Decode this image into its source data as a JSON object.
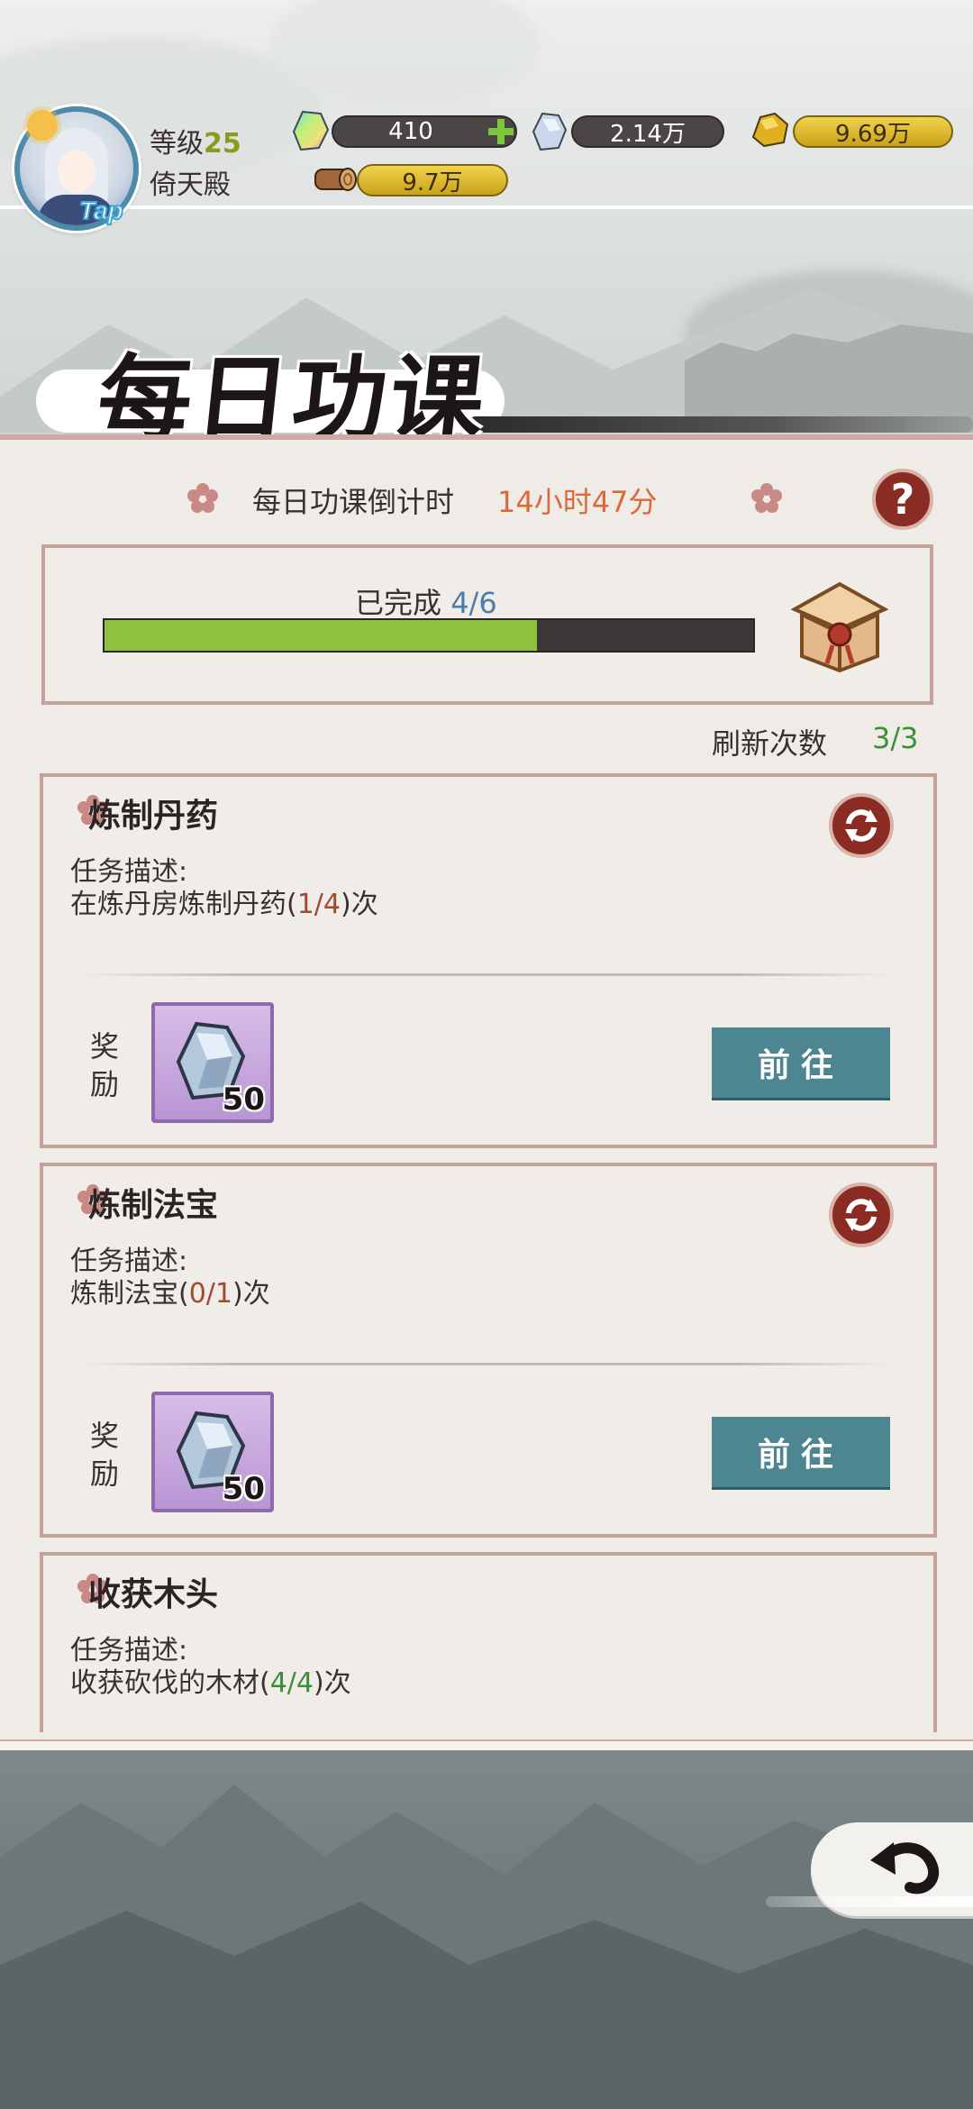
{
  "player": {
    "level_label": "等级",
    "level_value": "25",
    "sect_name": "倚天殿",
    "tap_badge": "Tap",
    "avatar_icon": "player-avatar"
  },
  "resources": [
    {
      "name": "spirit-stone-rainbow",
      "value": "410",
      "has_plus": true
    },
    {
      "name": "crystal",
      "value": "2.14万"
    },
    {
      "name": "gold-ore",
      "value": "9.69万"
    },
    {
      "name": "wood",
      "value": "9.7万"
    }
  ],
  "page": {
    "title": "每日功课",
    "timer_label": "每日功课倒计时",
    "timer_value": "14小时47分",
    "help_label": "?"
  },
  "progress": {
    "label": "已完成",
    "count": "4/6",
    "completed": 4,
    "total": 6,
    "reward_icon": "treasure-chest-icon"
  },
  "refresh": {
    "label": "刷新次数",
    "value": "3/3"
  },
  "tasks": [
    {
      "title": "炼制丹药",
      "desc_label": "任务描述:",
      "desc_prefix": "在炼丹房炼制丹药(",
      "desc_count": "1/4",
      "desc_suffix": ")次",
      "reward_label": "奖励",
      "reward_qty": "50",
      "reward_icon": "crystal-icon",
      "button_label": "前往",
      "done": false
    },
    {
      "title": "炼制法宝",
      "desc_label": "任务描述:",
      "desc_prefix": "炼制法宝(",
      "desc_count": "0/1",
      "desc_suffix": ")次",
      "reward_label": "奖励",
      "reward_qty": "50",
      "reward_icon": "crystal-icon",
      "button_label": "前往",
      "done": false
    },
    {
      "title": "收获木头",
      "desc_label": "任务描述:",
      "desc_prefix": "收获砍伐的木材(",
      "desc_count": "4/4",
      "desc_suffix": ")次",
      "done": true
    }
  ],
  "colors": {
    "accent_red": "#8a2c24",
    "progress_green": "#8dc13e",
    "timer_orange": "#d96a3a",
    "go_button": "#4d8591",
    "count_done": "#3c8f3a",
    "count_pending": "#a04a30"
  }
}
